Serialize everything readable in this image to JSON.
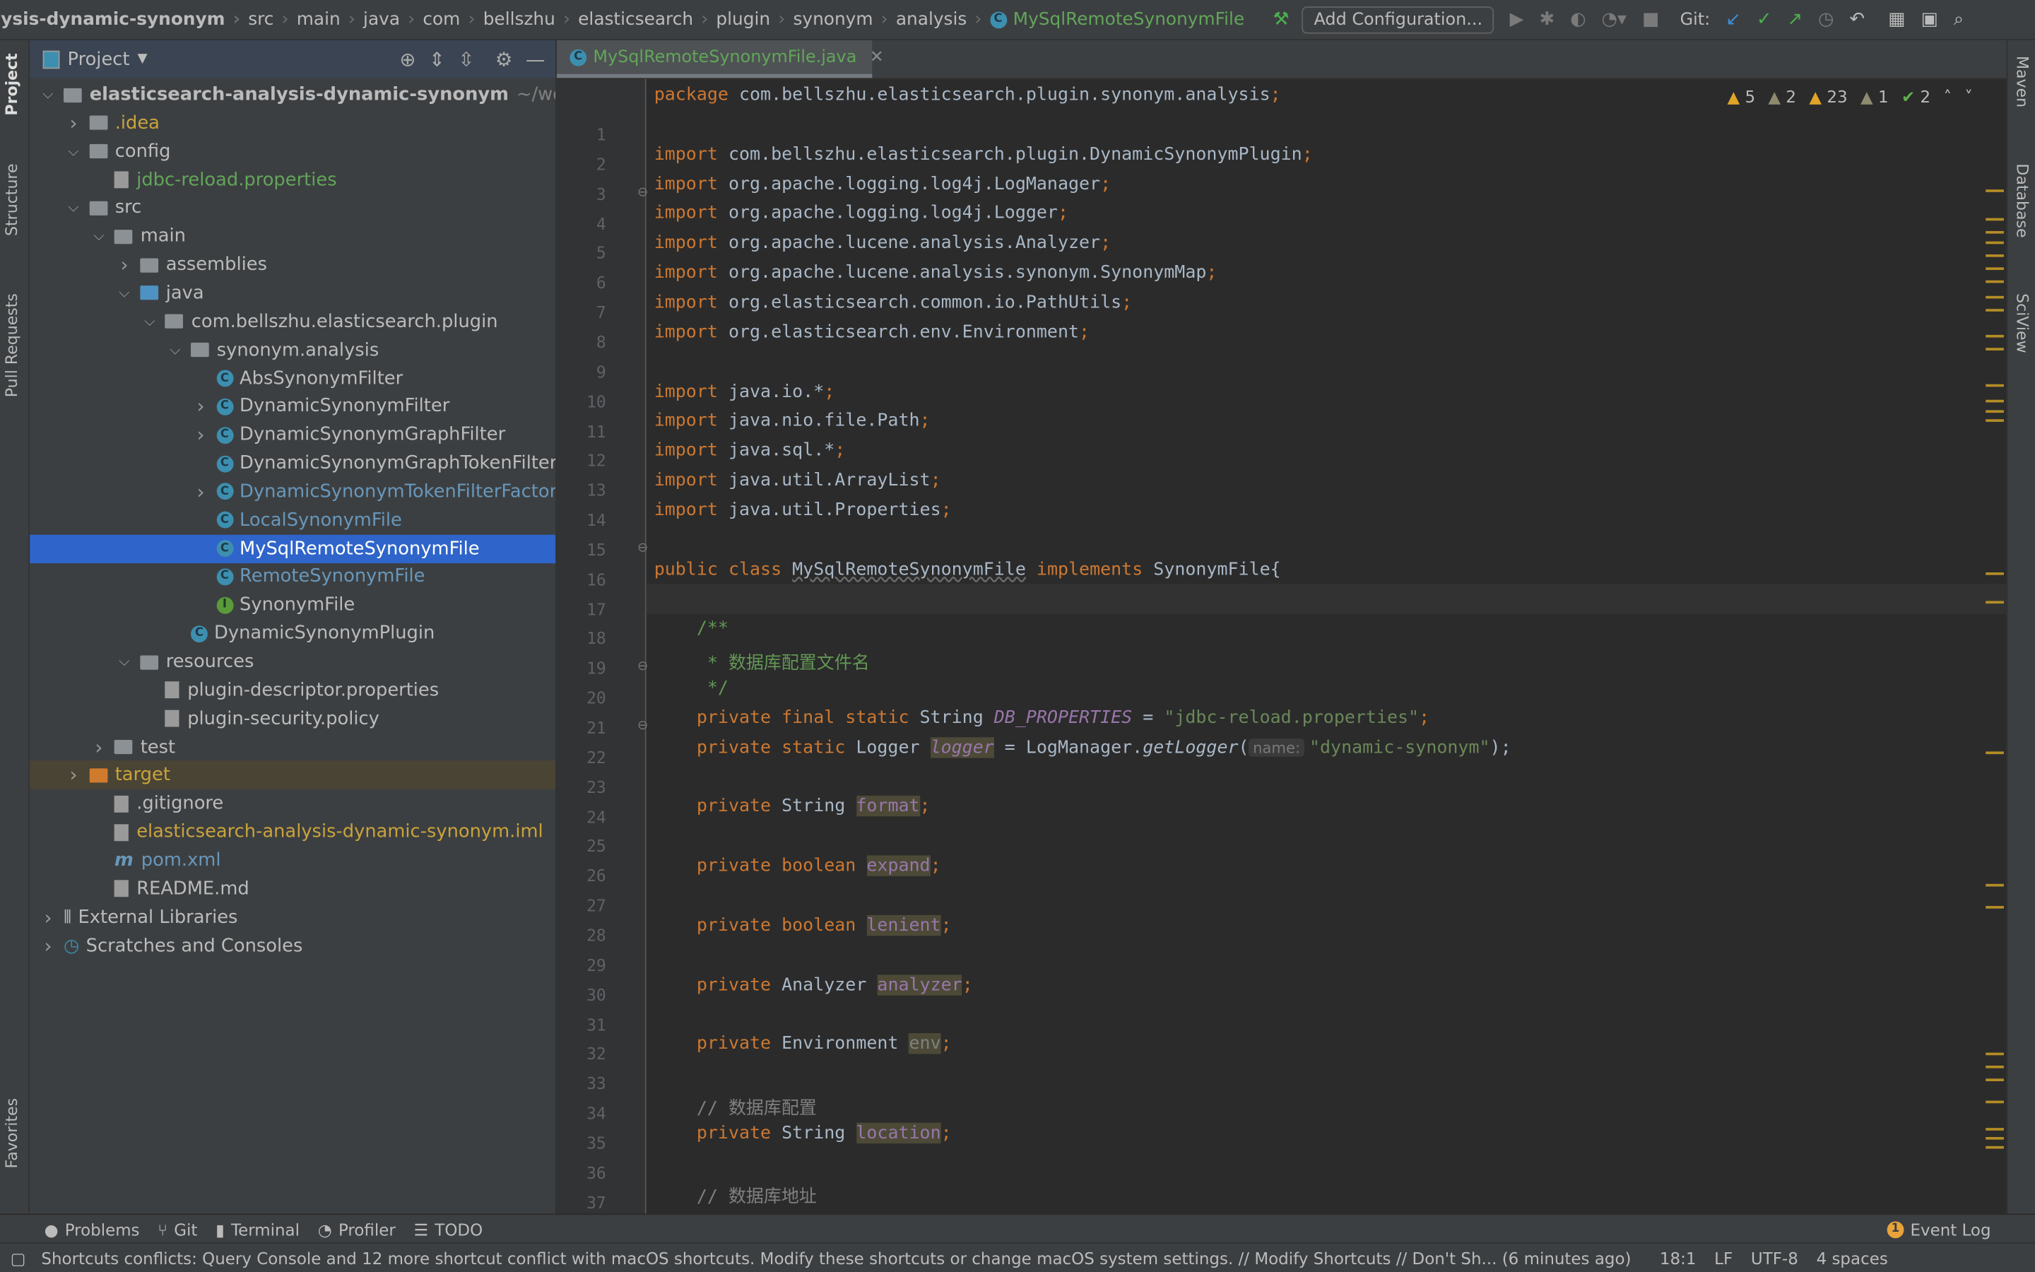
{
  "navbar": {
    "crumbs": [
      "lysis-dynamic-synonym",
      "src",
      "main",
      "java",
      "com",
      "bellszhu",
      "elasticsearch",
      "plugin",
      "synonym",
      "analysis"
    ],
    "current_file": "MySqlRemoteSynonymFile",
    "add_configuration": "Add Configuration...",
    "git_label": "Git:"
  },
  "left_strip": {
    "project": "Project",
    "structure": "Structure",
    "pull_requests": "Pull Requests",
    "favorites": "Favorites"
  },
  "right_strip": {
    "maven": "Maven",
    "database": "Database",
    "sciview": "SciView"
  },
  "project_panel": {
    "title": "Project",
    "tree": [
      {
        "label": "elasticsearch-analysis-dynamic-synonym",
        "suffix": "~/wo",
        "level": 0,
        "arrow": "open",
        "icon": "folder",
        "color": "#bbbbbb",
        "bold": true
      },
      {
        "label": ".idea",
        "level": 1,
        "arrow": "closed",
        "icon": "folder",
        "color": "#c9a33c"
      },
      {
        "label": "config",
        "level": 1,
        "arrow": "open",
        "icon": "folder",
        "color": "#bbbbbb"
      },
      {
        "label": "jdbc-reload.properties",
        "level": 2,
        "arrow": "",
        "icon": "file",
        "color": "#62a55a"
      },
      {
        "label": "src",
        "level": 1,
        "arrow": "open",
        "icon": "folder",
        "color": "#bbbbbb"
      },
      {
        "label": "main",
        "level": 2,
        "arrow": "open",
        "icon": "folder",
        "color": "#bbbbbb"
      },
      {
        "label": "assemblies",
        "level": 3,
        "arrow": "closed",
        "icon": "folder",
        "color": "#bbbbbb"
      },
      {
        "label": "java",
        "level": 3,
        "arrow": "open",
        "icon": "folder-blue",
        "color": "#bbbbbb"
      },
      {
        "label": "com.bellszhu.elasticsearch.plugin",
        "level": 4,
        "arrow": "open",
        "icon": "folder",
        "color": "#bbbbbb"
      },
      {
        "label": "synonym.analysis",
        "level": 5,
        "arrow": "open",
        "icon": "folder",
        "color": "#bbbbbb"
      },
      {
        "label": "AbsSynonymFilter",
        "level": 6,
        "arrow": "",
        "icon": "class",
        "color": "#bbbbbb"
      },
      {
        "label": "DynamicSynonymFilter",
        "level": 6,
        "arrow": "closed",
        "icon": "class",
        "color": "#bbbbbb"
      },
      {
        "label": "DynamicSynonymGraphFilter",
        "level": 6,
        "arrow": "closed",
        "icon": "class",
        "color": "#bbbbbb"
      },
      {
        "label": "DynamicSynonymGraphTokenFilterFactory",
        "level": 6,
        "arrow": "",
        "icon": "class",
        "color": "#bbbbbb"
      },
      {
        "label": "DynamicSynonymTokenFilterFactory",
        "level": 6,
        "arrow": "closed",
        "icon": "class",
        "color": "#6897bb"
      },
      {
        "label": "LocalSynonymFile",
        "level": 6,
        "arrow": "",
        "icon": "class",
        "color": "#6897bb"
      },
      {
        "label": "MySqlRemoteSynonymFile",
        "level": 6,
        "arrow": "",
        "icon": "class",
        "color": "#ffffff",
        "selected": true
      },
      {
        "label": "RemoteSynonymFile",
        "level": 6,
        "arrow": "",
        "icon": "class",
        "color": "#6897bb"
      },
      {
        "label": "SynonymFile",
        "level": 6,
        "arrow": "",
        "icon": "interface",
        "color": "#bbbbbb"
      },
      {
        "label": "DynamicSynonymPlugin",
        "level": 5,
        "arrow": "",
        "icon": "class",
        "color": "#bbbbbb"
      },
      {
        "label": "resources",
        "level": 3,
        "arrow": "open",
        "icon": "folder",
        "color": "#bbbbbb"
      },
      {
        "label": "plugin-descriptor.properties",
        "level": 4,
        "arrow": "",
        "icon": "file",
        "color": "#bbbbbb"
      },
      {
        "label": "plugin-security.policy",
        "level": 4,
        "arrow": "",
        "icon": "file",
        "color": "#bbbbbb"
      },
      {
        "label": "test",
        "level": 2,
        "arrow": "closed",
        "icon": "folder",
        "color": "#bbbbbb"
      },
      {
        "label": "target",
        "level": 1,
        "arrow": "closed",
        "icon": "folder-orange",
        "color": "#c9a33c",
        "highlight": true
      },
      {
        "label": ".gitignore",
        "level": 2,
        "arrow": "",
        "icon": "file",
        "color": "#bbbbbb"
      },
      {
        "label": "elasticsearch-analysis-dynamic-synonym.iml",
        "level": 2,
        "arrow": "",
        "icon": "file",
        "color": "#c9a33c"
      },
      {
        "label": "pom.xml",
        "level": 2,
        "arrow": "",
        "icon": "maven",
        "color": "#6897bb"
      },
      {
        "label": "README.md",
        "level": 2,
        "arrow": "",
        "icon": "file",
        "color": "#bbbbbb"
      },
      {
        "label": "External Libraries",
        "level": 0,
        "arrow": "closed",
        "icon": "library",
        "color": "#bbbbbb"
      },
      {
        "label": "Scratches and Consoles",
        "level": 0,
        "arrow": "closed",
        "icon": "scratch",
        "color": "#bbbbbb"
      }
    ]
  },
  "editor": {
    "tab_label": "MySqlRemoteSynonymFile.java",
    "current_line": 18,
    "inspections": {
      "warnings": "5",
      "weak_warnings": "2",
      "typos": "23",
      "info": "1",
      "ok": "2"
    },
    "lines": [
      [
        [
          "package ",
          "kw"
        ],
        [
          "com.bellszhu.elasticsearch.plugin.synonym.analysis",
          "plain"
        ],
        [
          ";",
          "kw"
        ]
      ],
      [],
      [
        [
          "import ",
          "kw"
        ],
        [
          "com.bellszhu.elasticsearch.plugin.DynamicSynonymPlugin",
          "plain"
        ],
        [
          ";",
          "kw"
        ]
      ],
      [
        [
          "import ",
          "kw"
        ],
        [
          "org.apache.logging.log4j.LogManager",
          "plain"
        ],
        [
          ";",
          "kw"
        ]
      ],
      [
        [
          "import ",
          "kw"
        ],
        [
          "org.apache.logging.log4j.Logger",
          "plain"
        ],
        [
          ";",
          "kw"
        ]
      ],
      [
        [
          "import ",
          "kw"
        ],
        [
          "org.apache.lucene.analysis.Analyzer",
          "plain"
        ],
        [
          ";",
          "kw"
        ]
      ],
      [
        [
          "import ",
          "kw"
        ],
        [
          "org.apache.lucene.analysis.synonym.SynonymMap",
          "plain"
        ],
        [
          ";",
          "kw"
        ]
      ],
      [
        [
          "import ",
          "kw"
        ],
        [
          "org.elasticsearch.common.io.PathUtils",
          "plain"
        ],
        [
          ";",
          "kw"
        ]
      ],
      [
        [
          "import ",
          "kw"
        ],
        [
          "org.elasticsearch.env.Environment",
          "plain"
        ],
        [
          ";",
          "kw"
        ]
      ],
      [],
      [
        [
          "import ",
          "kw"
        ],
        [
          "java.io.*",
          "plain"
        ],
        [
          ";",
          "kw"
        ]
      ],
      [
        [
          "import ",
          "kw"
        ],
        [
          "java.nio.file.Path",
          "plain"
        ],
        [
          ";",
          "kw"
        ]
      ],
      [
        [
          "import ",
          "kw"
        ],
        [
          "java.sql.*",
          "plain"
        ],
        [
          ";",
          "kw"
        ]
      ],
      [
        [
          "import ",
          "kw"
        ],
        [
          "java.util.ArrayList",
          "plain"
        ],
        [
          ";",
          "kw"
        ]
      ],
      [
        [
          "import ",
          "kw"
        ],
        [
          "java.util.Properties",
          "plain"
        ],
        [
          ";",
          "kw"
        ]
      ],
      [],
      [
        [
          "public class ",
          "kw"
        ],
        [
          "MySqlRemoteSynonymFile",
          "un"
        ],
        [
          " implements ",
          "kw"
        ],
        [
          "SynonymFile{",
          "plain"
        ]
      ],
      [],
      [
        [
          "    /**",
          "doc"
        ]
      ],
      [
        [
          "     * 数据库配置文件名",
          "doc"
        ]
      ],
      [
        [
          "     */",
          "doc"
        ]
      ],
      [
        [
          "    private final static ",
          "kw"
        ],
        [
          "String ",
          "plain"
        ],
        [
          "DB_PROPERTIES",
          "sfld"
        ],
        [
          " = ",
          "plain"
        ],
        [
          "\"jdbc-reload.properties\"",
          "str"
        ],
        [
          ";",
          "kw"
        ]
      ],
      [
        [
          "    private static ",
          "kw"
        ],
        [
          "Logger ",
          "plain"
        ],
        [
          "logger",
          "sfld hlb"
        ],
        [
          " = LogManager.",
          "plain"
        ],
        [
          "getLogger",
          "it"
        ],
        [
          "(",
          "plain"
        ],
        [
          "name:",
          "hint"
        ],
        [
          "\"dynamic-synonym\"",
          "str"
        ],
        [
          ");",
          "plain"
        ]
      ],
      [],
      [
        [
          "    private ",
          "kw"
        ],
        [
          "String ",
          "plain"
        ],
        [
          "format",
          "fld hlb"
        ],
        [
          ";",
          "kw"
        ]
      ],
      [],
      [
        [
          "    private boolean ",
          "kw"
        ],
        [
          "expand",
          "fld hlb"
        ],
        [
          ";",
          "kw"
        ]
      ],
      [],
      [
        [
          "    private boolean ",
          "kw"
        ],
        [
          "lenient",
          "fld hlb"
        ],
        [
          ";",
          "kw"
        ]
      ],
      [],
      [
        [
          "    private ",
          "kw"
        ],
        [
          "Analyzer ",
          "plain"
        ],
        [
          "analyzer",
          "fld hlb"
        ],
        [
          ";",
          "kw"
        ]
      ],
      [],
      [
        [
          "    private ",
          "kw"
        ],
        [
          "Environment ",
          "plain"
        ],
        [
          "env",
          "cm hlb"
        ],
        [
          ";",
          "kw"
        ]
      ],
      [],
      [
        [
          "    // 数据库配置",
          "cm"
        ]
      ],
      [
        [
          "    private ",
          "kw"
        ],
        [
          "String ",
          "plain"
        ],
        [
          "location",
          "fld hlb"
        ],
        [
          ";",
          "kw"
        ]
      ],
      [],
      [
        [
          "    // 数据库地址",
          "cm"
        ]
      ]
    ]
  },
  "bottom_toolbar": {
    "problems": "Problems",
    "git": "Git",
    "terminal": "Terminal",
    "profiler": "Profiler",
    "todo": "TODO",
    "event_log": "Event Log",
    "event_count": "1"
  },
  "status_bar": {
    "message": "Shortcuts conflicts: Query Console and 12 more shortcut conflict with macOS shortcuts. Modify these shortcuts or change macOS system settings. // Modify Shortcuts // Don't Sh... (6 minutes ago)",
    "position": "18:1",
    "line_sep": "LF",
    "encoding": "UTF-8",
    "indent": "4 spaces"
  },
  "colors": {
    "accent_selection": "#2f65ca",
    "keyword": "#cc7832",
    "string": "#6a8759",
    "field": "#9876aa",
    "warning": "#e0a526"
  }
}
